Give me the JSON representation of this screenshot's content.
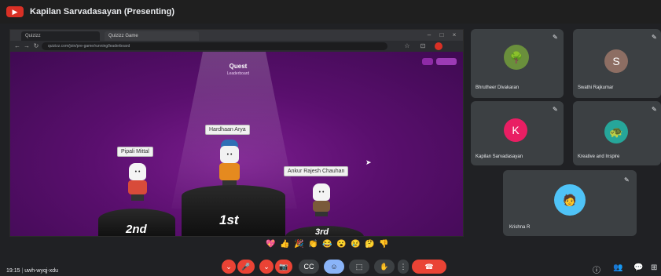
{
  "header": {
    "title": "Kapilan Sarvadasayan (Presenting)",
    "present_icon": "presenting-icon"
  },
  "browser": {
    "tab1": "Quizizz",
    "tab2": "Quizizz Game",
    "url": "quizizz.com/join/pre-game/running/leaderboard"
  },
  "stage": {
    "title": "Quest",
    "subtitle": "Leaderboard",
    "btn_exit": "",
    "btn_next": "",
    "players": [
      {
        "name": "Hardhaan Arya",
        "rank": "1st"
      },
      {
        "name": "Pipali Mittal",
        "rank": "2nd"
      },
      {
        "name": "Ankur Rajesh Chauhan",
        "rank": "3rd"
      }
    ]
  },
  "participants": [
    {
      "name": "Bhrutheer Divakaran",
      "initial": "",
      "color": "#6a8f3c"
    },
    {
      "name": "Swathi Rajkumar",
      "initial": "S",
      "color": "#8d6e63"
    },
    {
      "name": "Kapilan Sarvadasayan",
      "initial": "K",
      "color": "#e91e63"
    },
    {
      "name": "Kreative and Inspire",
      "initial": "",
      "color": "#26a69a"
    },
    {
      "name": "Krishna R",
      "initial": "",
      "color": "#4fc3f7"
    }
  ],
  "bottom": {
    "time": "19:15",
    "meeting_code": "uwh-wyqj-xdu",
    "end_label": "end-call"
  },
  "colors": {
    "accent": "#d93025",
    "stage": "#5a0f6e",
    "tile": "#3c4043"
  }
}
